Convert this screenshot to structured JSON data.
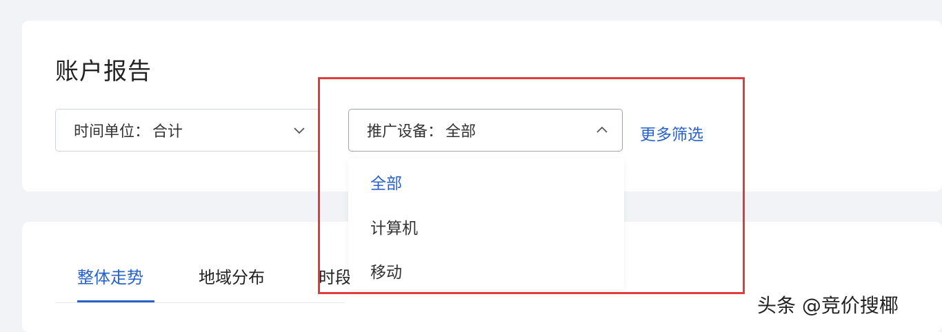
{
  "page": {
    "title": "账户报告"
  },
  "filters": {
    "time_unit": {
      "label": "时间单位：",
      "value": "合计"
    },
    "device": {
      "label": "推广设备：",
      "value": "全部"
    },
    "more_filters": "更多筛选"
  },
  "device_dropdown": {
    "options": [
      "全部",
      "计算机",
      "移动"
    ],
    "selected": "全部"
  },
  "tabs": [
    "整体走势",
    "地域分布",
    "时段分布"
  ],
  "active_tab": "整体走势",
  "watermark": "头条 @竞价搜椰",
  "colors": {
    "accent": "#2862c9",
    "highlight": "#e23a3a"
  }
}
